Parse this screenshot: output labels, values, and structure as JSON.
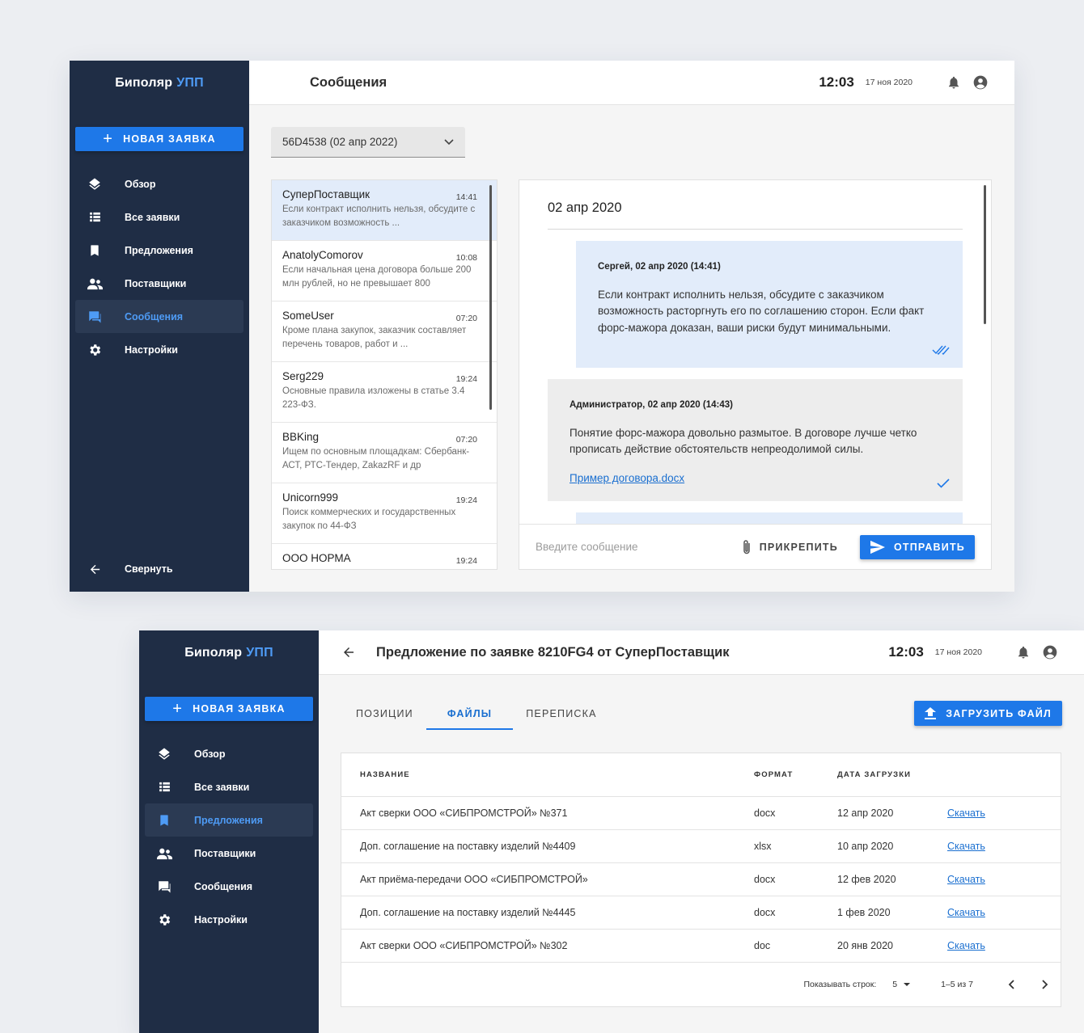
{
  "brand": {
    "name": "Биполяр",
    "accent": "УПП"
  },
  "colors": {
    "sidebar": "#1f2d45",
    "primary": "#1e78e8",
    "accent_text": "#4e9bf5",
    "bubble_out": "#e2ecfa",
    "bubble_in": "#ededed"
  },
  "sidebar": {
    "new_request": "НОВАЯ ЗАЯВКА",
    "items": [
      {
        "label": "Обзор",
        "icon": "layers-icon"
      },
      {
        "label": "Все заявки",
        "icon": "list-icon"
      },
      {
        "label": "Предложения",
        "icon": "bookmark-icon"
      },
      {
        "label": "Поставщики",
        "icon": "people-icon"
      },
      {
        "label": "Сообщения",
        "icon": "chat-icon"
      },
      {
        "label": "Настройки",
        "icon": "gear-icon"
      }
    ],
    "collapse": "Свернуть"
  },
  "messages_screen": {
    "header": {
      "title": "Сообщения",
      "time": "12:03",
      "date": "17 ноя 2020"
    },
    "request_select": "56D4538 (02 апр 2022)",
    "conversations": [
      {
        "name": "СуперПоставщик",
        "time": "14:41",
        "preview": "Если контракт исполнить нельзя, обсудите с заказчиком возможность ..."
      },
      {
        "name": "AnatolyComorov",
        "time": "10:08",
        "preview": "Если начальная цена договора больше 200 млн рублей, но не превышает 800"
      },
      {
        "name": "SomeUser",
        "time": "07:20",
        "preview": "Кроме плана закупок, заказчик составляет перечень товаров, работ и ..."
      },
      {
        "name": "Serg229",
        "time": "19:24",
        "preview": "Основные правила изложены в статье 3.4 223-ФЗ."
      },
      {
        "name": "BBKing",
        "time": "07:20",
        "preview": "Ищем по основным площадкам: Сбербанк-АСТ, РТС-Тендер, ZakazRF и др"
      },
      {
        "name": "Unicorn999",
        "time": "19:24",
        "preview": "Поиск коммерческих и государственных закупок по 44-ФЗ"
      },
      {
        "name": "ООО НОРМА",
        "time": "19:24",
        "preview": ""
      }
    ],
    "chat": {
      "date": "02 апр 2020",
      "messages": [
        {
          "author": "Сергей, 02 апр 2020 (14:41)",
          "text": "Если контракт исполнить нельзя, обсудите с заказчиком возможность расторгнуть его по соглашению сторон. Если факт форс-мажора доказан, ваши риски будут минимальными."
        },
        {
          "author": "Администратор, 02 апр 2020 (14:43)",
          "text": "Понятие форс-мажора довольно размытое. В договоре лучше четко прописать действие обстоятельств непреодолимой силы.",
          "attachment": "Пример договора.docx"
        }
      ],
      "input_placeholder": "Введите сообщение",
      "attach": "ПРИКРЕПИТЬ",
      "send": "ОТПРАВИТЬ"
    }
  },
  "proposal_screen": {
    "header": {
      "title": "Предложение по заявке 8210FG4 от СуперПоставщик",
      "time": "12:03",
      "date": "17 ноя 2020"
    },
    "tabs": [
      "ПОЗИЦИИ",
      "ФАЙЛЫ",
      "ПЕРЕПИСКА"
    ],
    "upload": "ЗАГРУЗИТЬ ФАЙЛ",
    "table": {
      "columns": [
        "НАЗВАНИЕ",
        "ФОРМАТ",
        "ДАТА ЗАГРУЗКИ"
      ],
      "rows": [
        {
          "name": "Акт сверки ООО «СИБПРОМСТРОЙ» №371",
          "format": "docx",
          "date": "12 апр 2020",
          "action": "Скачать"
        },
        {
          "name": "Доп. соглашение на поставку изделий №4409",
          "format": "xlsx",
          "date": "10 апр 2020",
          "action": "Скачать"
        },
        {
          "name": "Акт приёма-передачи ООО «СИБПРОМСТРОЙ»",
          "format": "docx",
          "date": "12 фев 2020",
          "action": "Скачать"
        },
        {
          "name": "Доп. соглашение на поставку изделий №4445",
          "format": "docx",
          "date": "1 фев 2020",
          "action": "Скачать"
        },
        {
          "name": "Акт сверки ООО «СИБПРОМСТРОЙ» №302",
          "format": "doc",
          "date": "20 янв 2020",
          "action": "Скачать"
        }
      ],
      "rows_per_page_label": "Показывать строк:",
      "rows_per_page": "5",
      "range": "1–5 из 7"
    }
  }
}
